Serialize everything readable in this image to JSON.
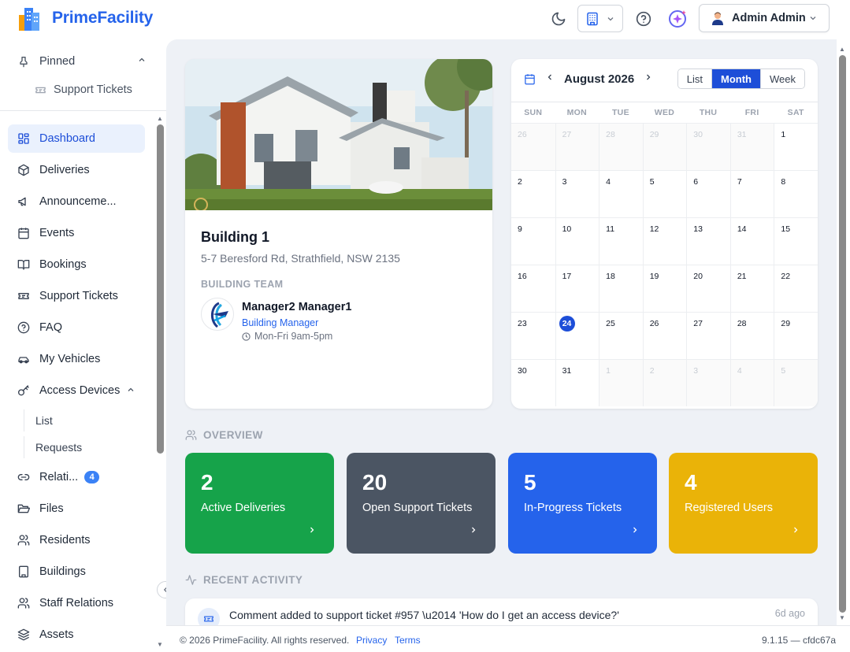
{
  "app": {
    "name": "PrimeFacility"
  },
  "header": {
    "user_name": "Admin Admin"
  },
  "sidebar": {
    "pinned_label": "Pinned",
    "pinned_items": [
      {
        "label": "Support Tickets"
      }
    ],
    "items": [
      {
        "label": "Dashboard",
        "active": true
      },
      {
        "label": "Deliveries"
      },
      {
        "label": "Announceme..."
      },
      {
        "label": "Events"
      },
      {
        "label": "Bookings"
      },
      {
        "label": "Support Tickets"
      },
      {
        "label": "FAQ"
      },
      {
        "label": "My Vehicles"
      },
      {
        "label": "Access Devices",
        "expanded": true
      },
      {
        "label": "Relati...",
        "badge": "4"
      },
      {
        "label": "Files"
      },
      {
        "label": "Residents"
      },
      {
        "label": "Buildings"
      },
      {
        "label": "Staff Relations"
      },
      {
        "label": "Assets"
      }
    ],
    "access_devices_sub": [
      {
        "label": "List"
      },
      {
        "label": "Requests"
      }
    ]
  },
  "building": {
    "name": "Building 1",
    "address": "5-7 Beresford Rd, Strathfield, NSW 2135",
    "team_label": "BUILDING TEAM",
    "manager": {
      "name": "Manager2 Manager1",
      "role": "Building Manager",
      "hours": "Mon-Fri 9am-5pm"
    }
  },
  "calendar": {
    "title": "August 2026",
    "views": [
      "List",
      "Month",
      "Week"
    ],
    "active_view": "Month",
    "dow": [
      "SUN",
      "MON",
      "TUE",
      "WED",
      "THU",
      "FRI",
      "SAT"
    ],
    "weeks": [
      [
        "26",
        "27",
        "28",
        "29",
        "30",
        "31",
        "1"
      ],
      [
        "2",
        "3",
        "4",
        "5",
        "6",
        "7",
        "8"
      ],
      [
        "9",
        "10",
        "11",
        "12",
        "13",
        "14",
        "15"
      ],
      [
        "16",
        "17",
        "18",
        "19",
        "20",
        "21",
        "22"
      ],
      [
        "23",
        "24",
        "25",
        "26",
        "27",
        "28",
        "29"
      ],
      [
        "30",
        "31",
        "1",
        "2",
        "3",
        "4",
        "5"
      ]
    ],
    "today": "24"
  },
  "overview": {
    "label": "OVERVIEW",
    "stats": [
      {
        "value": "2",
        "label": "Active Deliveries",
        "color": "#16a34a"
      },
      {
        "value": "20",
        "label": "Open Support Tickets",
        "color": "#4b5563"
      },
      {
        "value": "5",
        "label": "In-Progress Tickets",
        "color": "#2563eb"
      },
      {
        "value": "4",
        "label": "Registered Users",
        "color": "#eab308"
      }
    ]
  },
  "activity": {
    "label": "RECENT ACTIVITY",
    "items": [
      {
        "text": "Comment added to support ticket #957 \\u2014 'How do I get an access device?'",
        "time": "6d ago"
      }
    ]
  },
  "footer": {
    "copyright": "© 2026 PrimeFacility. All rights reserved.",
    "privacy": "Privacy",
    "terms": "Terms",
    "version": "9.1.15 — cfdc67a"
  }
}
